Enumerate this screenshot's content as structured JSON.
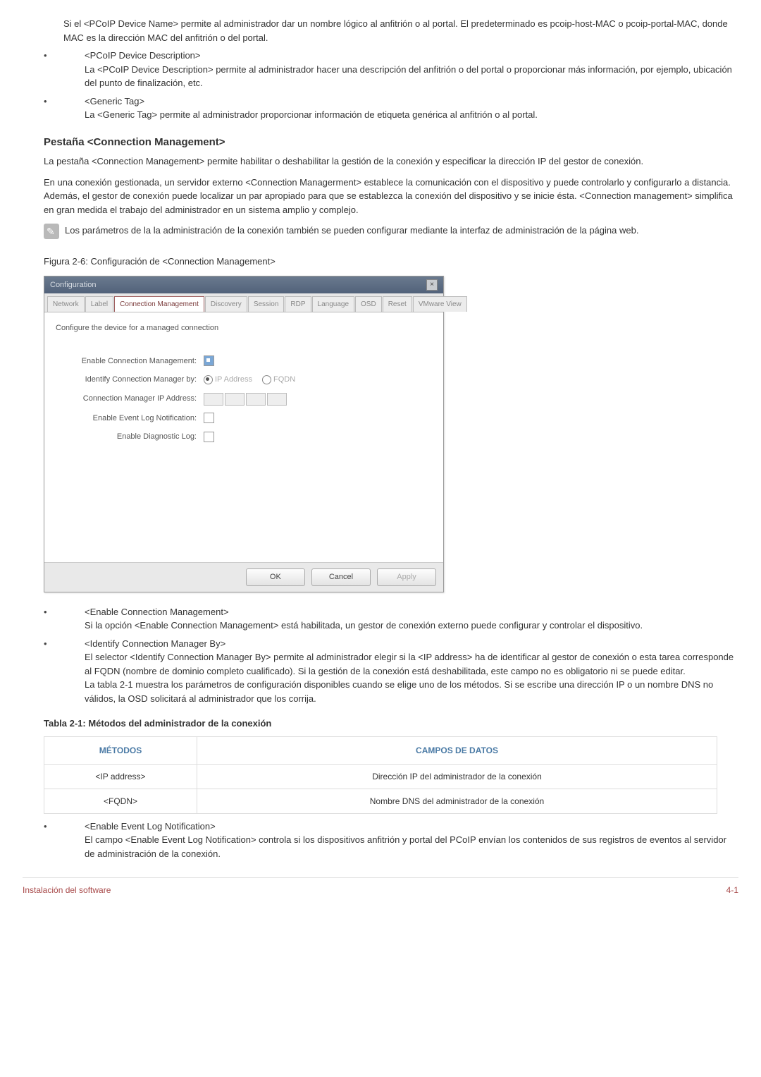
{
  "top": {
    "device_name_text": "Si el <PCoIP Device Name> permite al administrador dar un nombre lógico al anfitrión o al portal. El predeterminado es pcoip-host-MAC o pcoip-portal-MAC, donde MAC es la dirección MAC del anfitrión o del portal.",
    "device_desc_label": "<PCoIP Device Description>",
    "device_desc_text": "La <PCoIP Device Description> permite al administrador hacer una descripción del anfitrión o del portal o proporcionar más información, por ejemplo, ubicación del punto de finalización, etc.",
    "generic_tag_label": "<Generic Tag>",
    "generic_tag_text": "La <Generic Tag> permite al administrador proporcionar información de etiqueta genérica al anfitrión o al portal."
  },
  "section": {
    "heading": "Pestaña <Connection Management>",
    "p1": "La pestaña <Connection Management> permite habilitar o deshabilitar la gestión de la conexión y especificar la dirección IP del gestor de conexión.",
    "p2": "En una conexión gestionada, un servidor externo <Connection Managerment> establece la comunicación con el dispositivo y puede controlarlo y configurarlo a distancia. Además, el gestor de conexión puede localizar un par apropiado para que se establezca la conexión del dispositivo y se inicie ésta. <Connection management> simplifica en gran medida el trabajo del administrador en un sistema amplio y complejo.",
    "note": "Los parámetros de la la administración de la conexión también se pueden configurar mediante la interfaz de administración de la página web.",
    "fig_caption": "Figura 2-6: Configuración de <Connection Management>"
  },
  "dialog": {
    "title": "Configuration",
    "tabs": [
      "Network",
      "Label",
      "Connection Management",
      "Discovery",
      "Session",
      "RDP",
      "Language",
      "OSD",
      "Reset",
      "VMware View"
    ],
    "desc": "Configure the device for a managed connection",
    "rows": {
      "enable_cm": "Enable Connection Management:",
      "identify_by": "Identify Connection Manager by:",
      "ip_addr_opt": "IP Address",
      "fqdn_opt": "FQDN",
      "cm_ip": "Connection Manager IP Address:",
      "event_log": "Enable Event Log Notification:",
      "diag_log": "Enable Diagnostic Log:"
    },
    "buttons": {
      "ok": "OK",
      "cancel": "Cancel",
      "apply": "Apply"
    }
  },
  "post": {
    "b1_label": "<Enable Connection Management>",
    "b1_text": "Si la opción <Enable Connection Management> está habilitada, un gestor de conexión externo puede configurar y controlar el dispositivo.",
    "b2_label": "<Identify Connection Manager By>",
    "b2_text1": "El selector <Identify Connection Manager By> permite al administrador elegir si la <IP address> ha de identificar al gestor de conexión o esta tarea corresponde al FQDN (nombre de dominio completo cualificado). Si la gestión de la conexión está deshabilitada, este campo no es obligatorio ni se puede editar.",
    "b2_text2": "La tabla 2-1 muestra los parámetros de configuración disponibles cuando se elige uno de los métodos. Si se escribe una dirección IP o un nombre DNS no válidos, la OSD solicitará al administrador que los corrija."
  },
  "table": {
    "title": "Tabla 2-1: Métodos del administrador de la conexión",
    "h1": "MÉTODOS",
    "h2": "CAMPOS DE DATOS",
    "r1c1": "<IP address>",
    "r1c2": "Dirección IP del administrador de la conexión",
    "r2c1": "<FQDN>",
    "r2c2": "Nombre DNS del administrador de la conexión"
  },
  "post2": {
    "b3_label": "<Enable Event Log Notification>",
    "b3_text": "El campo <Enable Event Log Notification> controla si los dispositivos anfitrión y portal del PCoIP envían los contenidos de sus registros de eventos al servidor de administración de la conexión."
  },
  "footer": {
    "left": "Instalación del software",
    "right": "4-1"
  }
}
